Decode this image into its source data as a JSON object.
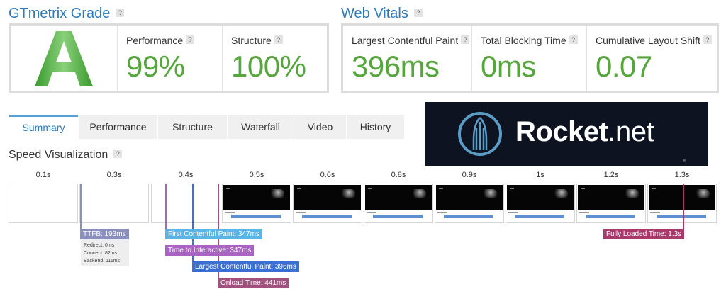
{
  "grade_section": {
    "title": "GTmetrix Grade",
    "help": "?",
    "grade": "A",
    "performance": {
      "label": "Performance",
      "value": "99%"
    },
    "structure": {
      "label": "Structure",
      "value": "100%"
    }
  },
  "web_vitals": {
    "title": "Web Vitals",
    "help": "?",
    "lcp": {
      "label": "Largest Contentful Paint",
      "value": "396ms"
    },
    "tbt": {
      "label": "Total Blocking Time",
      "value": "0ms"
    },
    "cls": {
      "label": "Cumulative Layout Shift",
      "value": "0.07"
    }
  },
  "tabs": [
    {
      "label": "Summary",
      "active": true
    },
    {
      "label": "Performance",
      "active": false
    },
    {
      "label": "Structure",
      "active": false
    },
    {
      "label": "Waterfall",
      "active": false
    },
    {
      "label": "Video",
      "active": false
    },
    {
      "label": "History",
      "active": false
    }
  ],
  "ad": {
    "brand": "Rocket",
    "suffix": ".net"
  },
  "speed": {
    "title": "Speed Visualization",
    "help": "?",
    "times": [
      "0.1s",
      "0.3s",
      "0.4s",
      "0.5s",
      "0.6s",
      "0.8s",
      "0.9s",
      "1s",
      "1.2s",
      "1.3s"
    ],
    "markers": {
      "ttfb": "TTFB: 193ms",
      "fcp": "First Contentful Paint: 347ms",
      "tti": "Time to Interactive: 347ms",
      "lcp": "Largest Contentful Paint: 396ms",
      "onload": "Onload Time: 441ms",
      "fully_loaded": "Fully Loaded Time: 1.3s"
    },
    "ttfb_detail": {
      "redirect": "Redirect: 0ms",
      "connect": "Connect: 82ms",
      "backend": "Backend: 111ms"
    }
  },
  "colors": {
    "accent_blue": "#2c7bbf",
    "grade_green": "#5cb346",
    "value_green": "#55a63b",
    "ttfb": "#8a8fc0",
    "fcp": "#5bb4e8",
    "tti": "#a964c2",
    "lcp": "#3b6fd3",
    "onload": "#a0517e",
    "fully_loaded": "#a8396b"
  }
}
